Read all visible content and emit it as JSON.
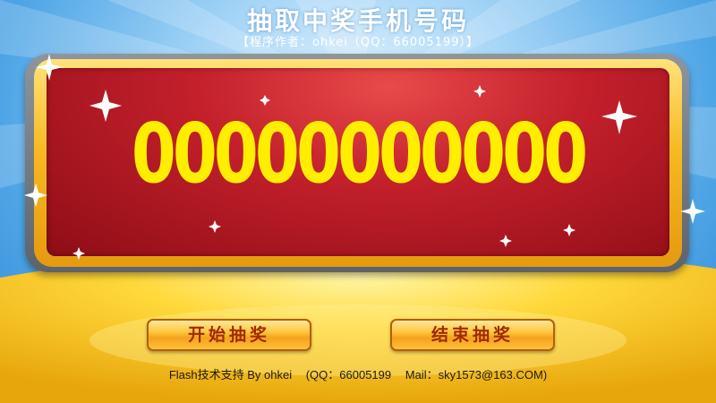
{
  "header": {
    "title": "抽取中奖手机号码",
    "subtitle": "【程序作者：ohkei（QQ：66005199）】"
  },
  "display": {
    "number": "00000000000"
  },
  "buttons": {
    "start_label": "开始抽奖",
    "end_label": "结束抽奖"
  },
  "footer": {
    "support": "Flash技术支持 By ohkei",
    "qq": "(QQ：66005199",
    "mail": "Mail：sky1573@163.COM)"
  },
  "colors": {
    "sky": "#4fa6e6",
    "board_red": "#c3202b",
    "board_gold": "#f6b820",
    "number": "#ffee00",
    "button_text": "#a02a00"
  }
}
